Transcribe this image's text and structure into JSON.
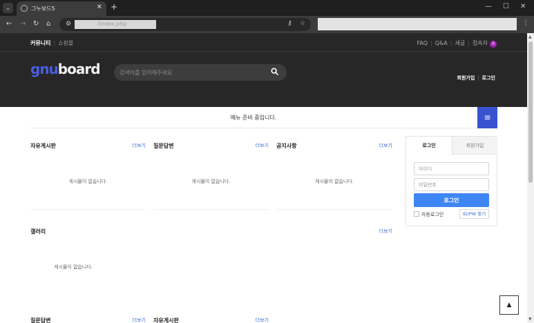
{
  "browser": {
    "tab_title": "그누보드5",
    "tab_close": "✕",
    "new_tab": "+",
    "url_visible": "/index.php",
    "window_controls": [
      "—",
      "☐",
      "✕"
    ]
  },
  "site": {
    "tnb": {
      "community": "커뮤니티",
      "shop": "쇼핑몰",
      "faq": "FAQ",
      "qa": "Q&A",
      "new": "새글",
      "visitors_label": "접속자",
      "visitors_count": "0"
    },
    "logo": {
      "part1": "gnu",
      "part2": "board"
    },
    "search": {
      "placeholder": "검색어를 입력해주세요"
    },
    "header_auth": {
      "join": "회원가입",
      "login": "로그인"
    },
    "menu": {
      "notice": "메뉴 준비 중입니다."
    },
    "widgets": [
      {
        "title": "자유게시판",
        "more": "더보기",
        "empty": "게시물이 없습니다."
      },
      {
        "title": "질문답변",
        "more": "더보기",
        "empty": "게시물이 없습니다."
      },
      {
        "title": "공지사항",
        "more": "더보기",
        "empty": "게시물이 없습니다."
      }
    ],
    "gallery": {
      "title": "갤러리",
      "more": "더보기",
      "empty": "게시물이 없습니다."
    },
    "bottom_widgets": [
      {
        "title": "질문답변",
        "more": "더보기"
      },
      {
        "title": "자유게시판",
        "more": "더보기"
      }
    ],
    "login_box": {
      "tab_login": "로그인",
      "tab_join": "회원가입",
      "id_placeholder": "아이디",
      "pw_placeholder": "비밀번호",
      "submit": "로그인",
      "auto_login": "자동로그인",
      "find": "ID/PW 찾기"
    },
    "icons": {
      "search": "search-icon",
      "menu": "hamburger-menu-icon",
      "top": "arrow-up-icon"
    },
    "colors": {
      "header_bg": "#272727",
      "logo_blue": "#4b5de0",
      "menu_button": "#3a52d1",
      "login_button": "#3f86f5",
      "more_link": "#3c6bd4",
      "badge": "#a91fbd"
    }
  }
}
